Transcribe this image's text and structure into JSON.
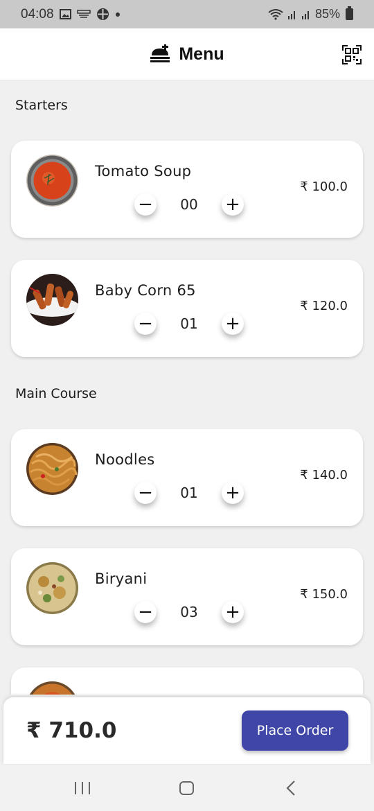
{
  "status": {
    "time": "04:08",
    "battery": "85%",
    "left_icons": [
      "gallery-icon",
      "cast-icon",
      "pinwheel-icon",
      "dot-icon"
    ],
    "right_icons": [
      "wifi-icon",
      "signal-icon",
      "signal-icon",
      "battery-icon"
    ]
  },
  "header": {
    "title": "Menu",
    "icon": "food-tray-icon",
    "action_icon": "qr-scanner-icon"
  },
  "sections": [
    {
      "title": "Starters",
      "items": [
        {
          "name": "Tomato Soup",
          "price": "₹ 100.0",
          "qty": "00",
          "image": "tomato-soup-photo"
        },
        {
          "name": "Baby Corn 65",
          "price": "₹ 120.0",
          "qty": "01",
          "image": "baby-corn-photo"
        }
      ]
    },
    {
      "title": "Main Course",
      "items": [
        {
          "name": "Noodles",
          "price": "₹ 140.0",
          "qty": "01",
          "image": "noodles-photo"
        },
        {
          "name": "Biryani",
          "price": "₹ 150.0",
          "qty": "03",
          "image": "biryani-photo"
        }
      ]
    }
  ],
  "controls": {
    "minus": "−",
    "plus": "+"
  },
  "order": {
    "total": "₹ 710.0",
    "button": "Place Order"
  },
  "colors": {
    "accent": "#3f46a8",
    "background": "#f0f0f0",
    "statusbar": "#c9c9c9"
  }
}
